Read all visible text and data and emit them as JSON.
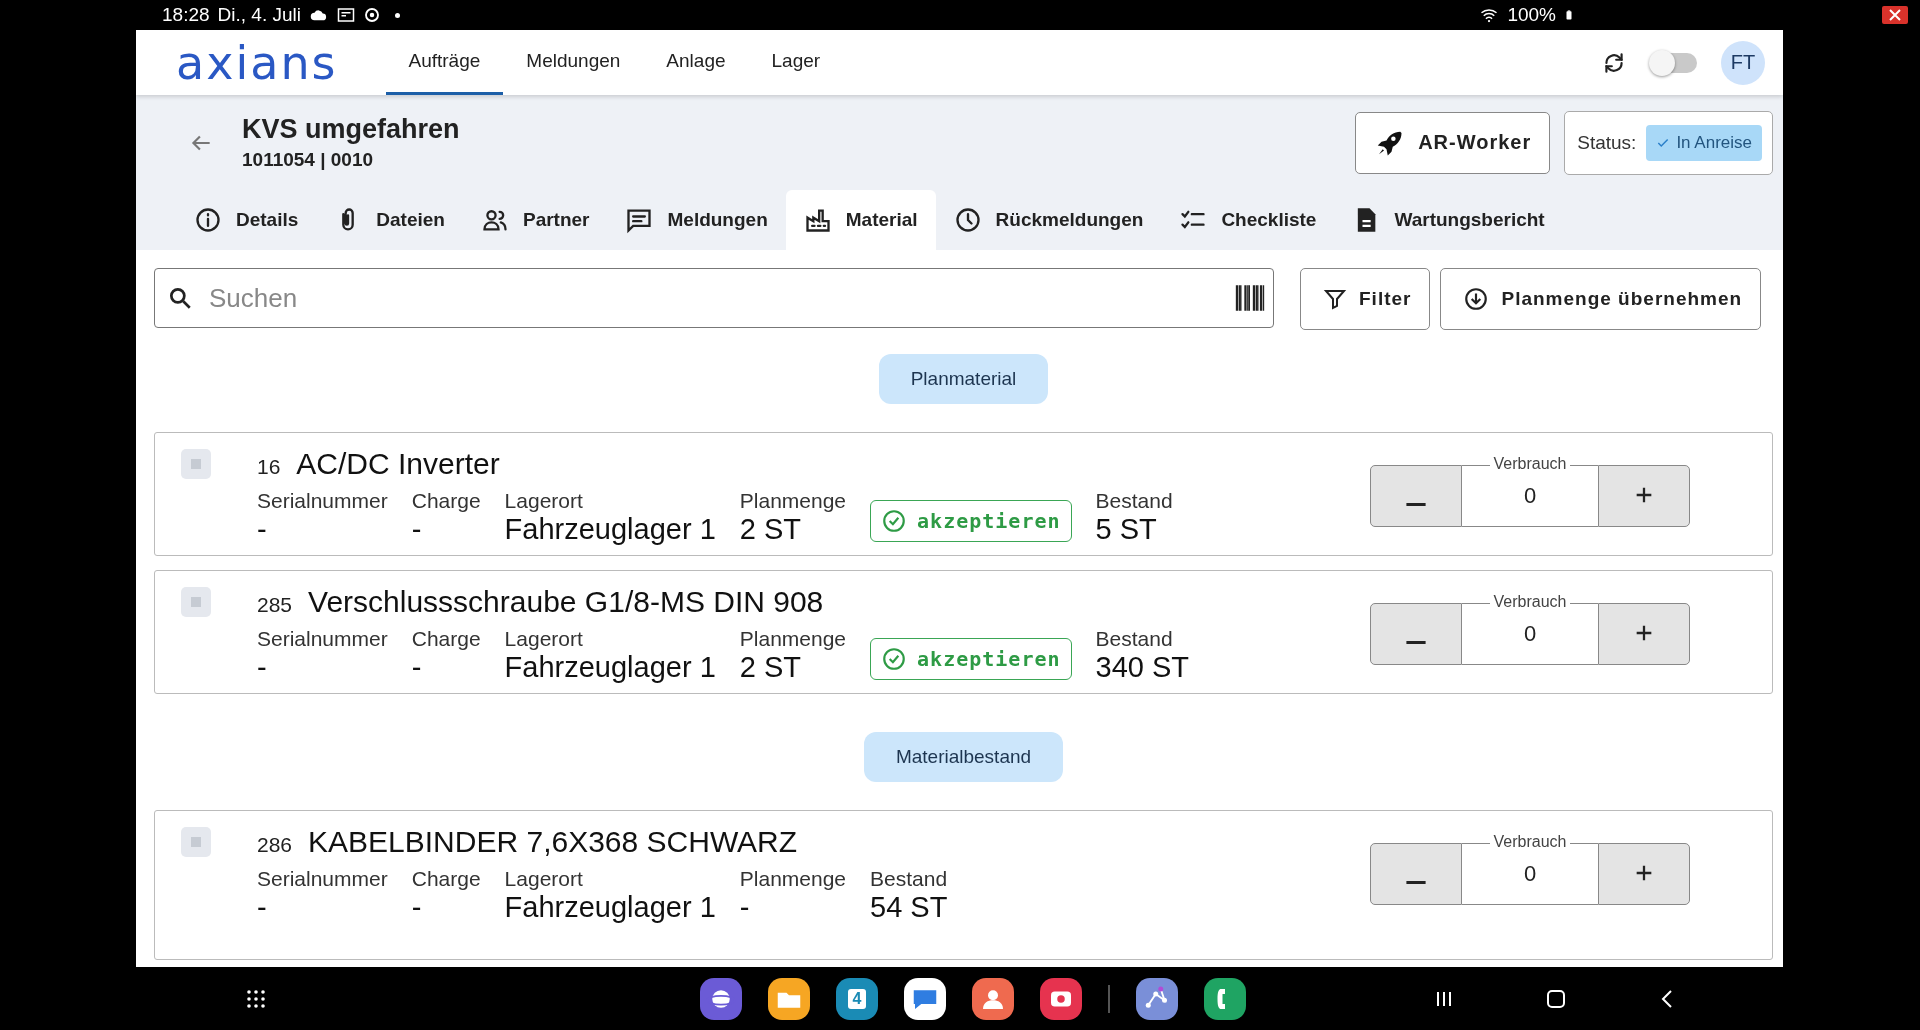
{
  "status_bar": {
    "time": "18:28",
    "date": "Di., 4. Juli",
    "battery": "100%"
  },
  "app_bar": {
    "logo": "axians",
    "nav": [
      {
        "label": "Aufträge",
        "selected": true
      },
      {
        "label": "Meldungen",
        "selected": false
      },
      {
        "label": "Anlage",
        "selected": false
      },
      {
        "label": "Lager",
        "selected": false
      }
    ],
    "toggle_on": false,
    "avatar": "FT"
  },
  "order": {
    "title": "KVS umgefahren",
    "subtitle": "1011054 | 0010",
    "ar_button": "AR-Worker",
    "status_label": "Status:",
    "status_value": "In Anreise"
  },
  "tabs": [
    {
      "label": "Details",
      "selected": false
    },
    {
      "label": "Dateien",
      "selected": false
    },
    {
      "label": "Partner",
      "selected": false
    },
    {
      "label": "Meldungen",
      "selected": false
    },
    {
      "label": "Material",
      "selected": true
    },
    {
      "label": "Rückmeldungen",
      "selected": false
    },
    {
      "label": "Checkliste",
      "selected": false
    },
    {
      "label": "Wartungsbericht",
      "selected": false
    }
  ],
  "search": {
    "placeholder": "Suchen",
    "filter": "Filter",
    "take_over": "Planmenge übernehmen"
  },
  "sections": [
    {
      "heading": "Planmaterial",
      "items": [
        {
          "number": "16",
          "name": "AC/DC Inverter",
          "checked": false,
          "fields": [
            {
              "kind": "field",
              "label": "Serialnummer",
              "value": "-"
            },
            {
              "kind": "field",
              "label": "Charge",
              "value": "-"
            },
            {
              "kind": "field",
              "label": "Lagerort",
              "value": "Fahrzeuglager 1"
            },
            {
              "kind": "field",
              "label": "Planmenge",
              "value": "2 ST"
            },
            {
              "kind": "accept",
              "label": "akzeptieren"
            },
            {
              "kind": "field",
              "label": "Bestand",
              "value": "5 ST"
            }
          ],
          "consumption_label": "Verbrauch",
          "consumption": "0"
        },
        {
          "number": "285",
          "name": "Verschlussschraube G1/8-MS DIN 908",
          "checked": false,
          "fields": [
            {
              "kind": "field",
              "label": "Serialnummer",
              "value": "-"
            },
            {
              "kind": "field",
              "label": "Charge",
              "value": "-"
            },
            {
              "kind": "field",
              "label": "Lagerort",
              "value": "Fahrzeuglager 1"
            },
            {
              "kind": "field",
              "label": "Planmenge",
              "value": "2 ST"
            },
            {
              "kind": "accept",
              "label": "akzeptieren"
            },
            {
              "kind": "field",
              "label": "Bestand",
              "value": "340 ST"
            }
          ],
          "consumption_label": "Verbrauch",
          "consumption": "0"
        }
      ]
    },
    {
      "heading": "Materialbestand",
      "items": [
        {
          "number": "286",
          "name": "KABELBINDER 7,6X368 SCHWARZ",
          "checked": false,
          "fields": [
            {
              "kind": "field",
              "label": "Serialnummer",
              "value": "-"
            },
            {
              "kind": "field",
              "label": "Charge",
              "value": "-"
            },
            {
              "kind": "field",
              "label": "Lagerort",
              "value": "Fahrzeuglager 1"
            },
            {
              "kind": "field",
              "label": "Planmenge",
              "value": "-"
            },
            {
              "kind": "field",
              "label": "Bestand",
              "value": "54 ST"
            }
          ],
          "consumption_label": "Verbrauch",
          "consumption": "0"
        }
      ]
    }
  ],
  "dock": {
    "calendar_day": "4"
  }
}
